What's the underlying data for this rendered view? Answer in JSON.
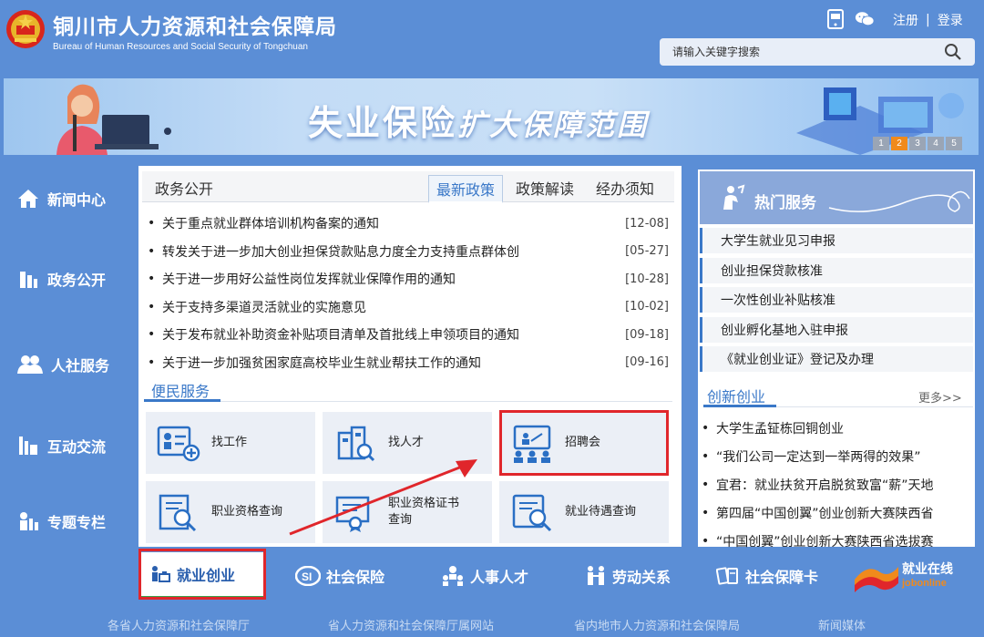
{
  "header": {
    "title_cn": "铜川市人力资源和社会保障局",
    "title_en": "Bureau of Human Resources and Social Security of Tongchuan",
    "register": "注册",
    "separator": "|",
    "login": "登录",
    "search_placeholder": "请输入关键字搜索"
  },
  "banner": {
    "text_a": "失业保险",
    "text_b": "扩大保障范围",
    "pages": [
      "1",
      "2",
      "3",
      "4",
      "5"
    ],
    "active_page": "2"
  },
  "leftnav": [
    {
      "label": "新闻中心",
      "icon": "home-icon"
    },
    {
      "label": "政务公开",
      "icon": "building-icon"
    },
    {
      "label": "人社服务",
      "icon": "people-icon"
    },
    {
      "label": "互动交流",
      "icon": "chat-icon"
    },
    {
      "label": "专题专栏",
      "icon": "topic-icon"
    }
  ],
  "tabs": {
    "first": "政务公开",
    "active": "最新政策",
    "t3": "政策解读",
    "t4": "经办须知"
  },
  "news": [
    {
      "title": "关于重点就业群体培训机构备案的通知",
      "date": "[12-08]"
    },
    {
      "title": "转发关于进一步加大创业担保贷款贴息力度全力支持重点群体创",
      "date": "[05-27]"
    },
    {
      "title": "关于进一步用好公益性岗位发挥就业保障作用的通知",
      "date": "[10-28]"
    },
    {
      "title": "关于支持多渠道灵活就业的实施意见",
      "date": "[10-02]"
    },
    {
      "title": "关于发布就业补助资金补贴项目清单及首批线上申领项目的通知",
      "date": "[09-18]"
    },
    {
      "title": "关于进一步加强贫困家庭高校毕业生就业帮扶工作的通知",
      "date": "[09-16]"
    }
  ],
  "bianmin": {
    "title": "便民服务",
    "items": [
      {
        "label": "找工作",
        "icon": "find-job-icon"
      },
      {
        "label": "找人才",
        "icon": "find-talent-icon"
      },
      {
        "label": "招聘会",
        "icon": "job-fair-icon"
      },
      {
        "label": "职业资格查询",
        "icon": "qualification-search-icon"
      },
      {
        "label_1": "职业资格证书",
        "label_2": "查询",
        "icon": "certificate-search-icon"
      },
      {
        "label": "就业待遇查询",
        "icon": "benefit-search-icon"
      }
    ]
  },
  "hot": {
    "title": "热门服务",
    "items": [
      "大学生就业见习申报",
      "创业担保贷款核准",
      "一次性创业补贴核准",
      "创业孵化基地入驻申报",
      "《就业创业证》登记及办理"
    ]
  },
  "chuangxin": {
    "title": "创新创业",
    "more": "更多>>",
    "items": [
      "大学生孟钲栋回铜创业",
      "“我们公司一定达到一举两得的效果”",
      "宜君：就业扶贫开启脱贫致富“薪”天地",
      "第四届“中国创翼”创业创新大赛陕西省",
      "“中国创翼”创业创新大赛陕西省选拔赛"
    ]
  },
  "bottombar": {
    "items": [
      "就业创业",
      "社会保险",
      "人事人才",
      "劳动关系",
      "社会保障卡"
    ],
    "logo_text": "就业在线",
    "logo_sub": "jobonline"
  },
  "footer": [
    "各省人力资源和社会保障厅",
    "省人力资源和社会保障厅属网站",
    "省内地市人力资源和社会保障局",
    "新闻媒体"
  ],
  "colors": {
    "bg": "#5b8ed6",
    "accent": "#3a78c8",
    "highlight": "#e0262b",
    "pager_active": "#f08a1c"
  }
}
